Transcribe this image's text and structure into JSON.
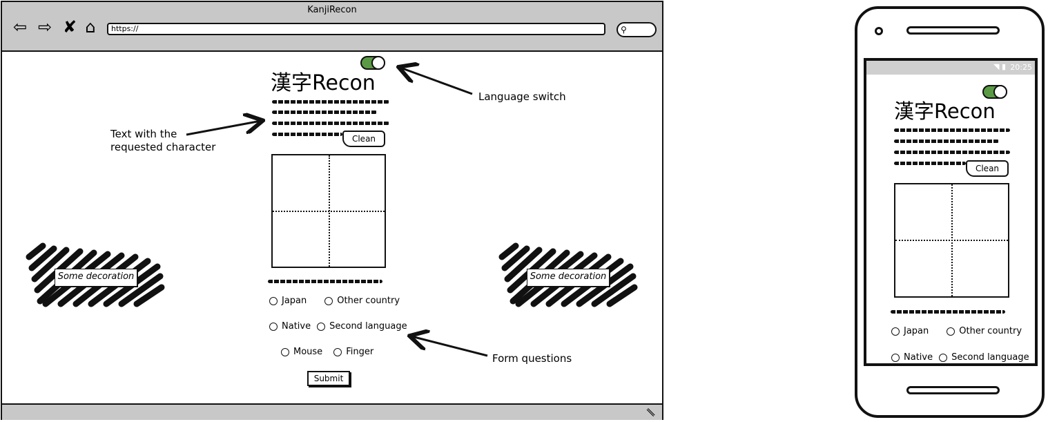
{
  "browser": {
    "title": "KanjiRecon",
    "address": "https://",
    "search_icon": "search-icon"
  },
  "app": {
    "logo": "漢字Recon",
    "clean_label": "Clean",
    "submit_label": "Submit",
    "toggle_color": "#5a9a45",
    "options": {
      "country": [
        "Japan",
        "Other country"
      ],
      "language": [
        "Native",
        "Second language"
      ],
      "input": [
        "Mouse",
        "Finger"
      ]
    }
  },
  "annotations": {
    "language_switch": "Language switch",
    "text_requested_line1": "Text with the",
    "text_requested_line2": "requested character",
    "form_questions": "Form questions"
  },
  "decorations": {
    "left_label": "Some decoration",
    "right_label": "Some decoration"
  },
  "phone": {
    "time": "20:25",
    "logo": "漢字Recon",
    "clean_label": "Clean",
    "options": {
      "country": [
        "Japan",
        "Other country"
      ],
      "language": [
        "Native",
        "Second language"
      ]
    }
  }
}
